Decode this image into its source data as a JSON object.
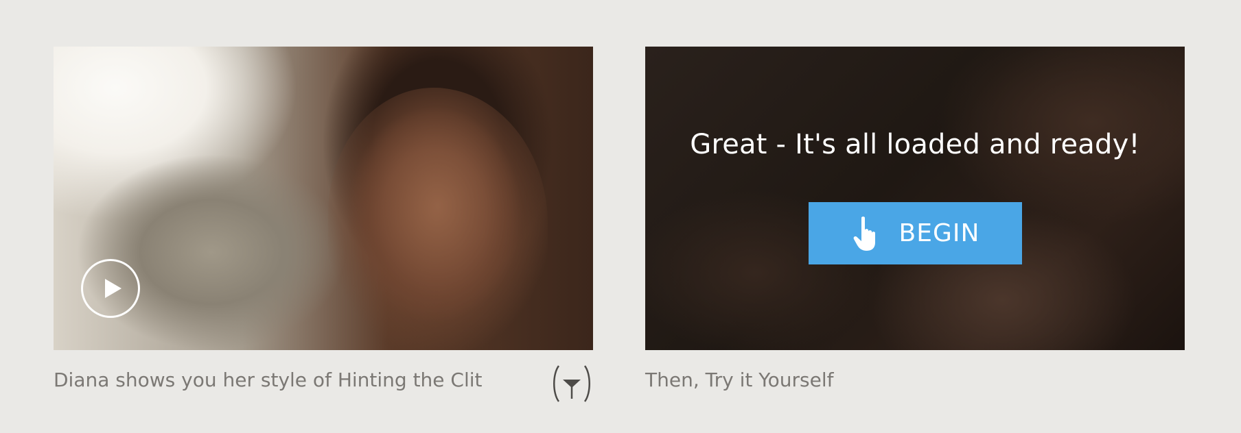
{
  "left_card": {
    "play_label": "Play video",
    "caption": "Diana shows you her style of Hinting the Clit",
    "brand_icon": "glass-in-parentheses-icon"
  },
  "right_card": {
    "message": "Great - It's all loaded and ready!",
    "button_label": "BEGIN",
    "button_icon": "pointing-hand-icon",
    "caption": "Then, Try it Yourself"
  },
  "colors": {
    "background": "#eae9e6",
    "button": "#4aa6e6",
    "caption_text": "#7b7874",
    "overlay_text": "#ffffff"
  }
}
